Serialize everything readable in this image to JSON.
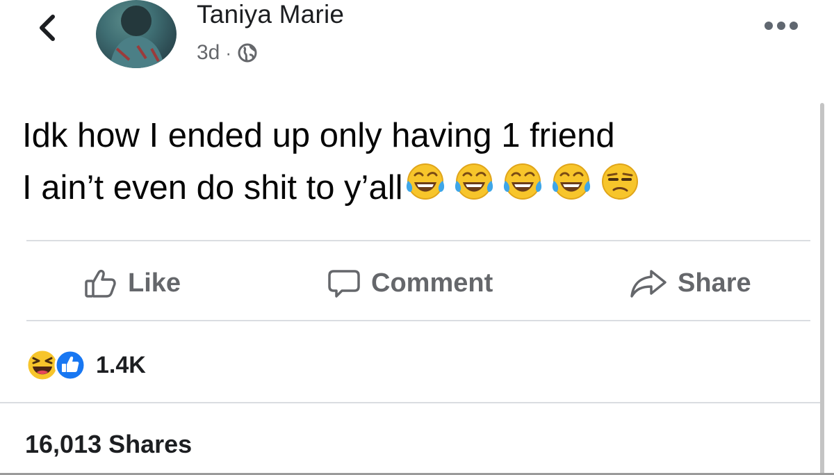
{
  "post": {
    "author": "Taniya Marie",
    "timestamp": "3d",
    "separator": "·",
    "audience_icon": "globe-icon",
    "text_line1": "Idk how I ended up only having 1 friend",
    "text_line2": "I ain’t even do shit to y’all",
    "emojis": [
      "face-with-tears-of-joy",
      "face-with-tears-of-joy",
      "face-with-tears-of-joy",
      "face-with-tears-of-joy",
      "unamused-face"
    ]
  },
  "actions": {
    "like_label": "Like",
    "comment_label": "Comment",
    "share_label": "Share"
  },
  "stats": {
    "reaction_icons": [
      "haha-reaction-icon",
      "like-reaction-icon"
    ],
    "reaction_count": "1.4K",
    "shares": "16,013 Shares"
  },
  "colors": {
    "text": "#050505",
    "secondary": "#65676b",
    "like_blue": "#1877f2",
    "emoji_yellow": "#f7c52b",
    "divider": "#dadde1"
  }
}
